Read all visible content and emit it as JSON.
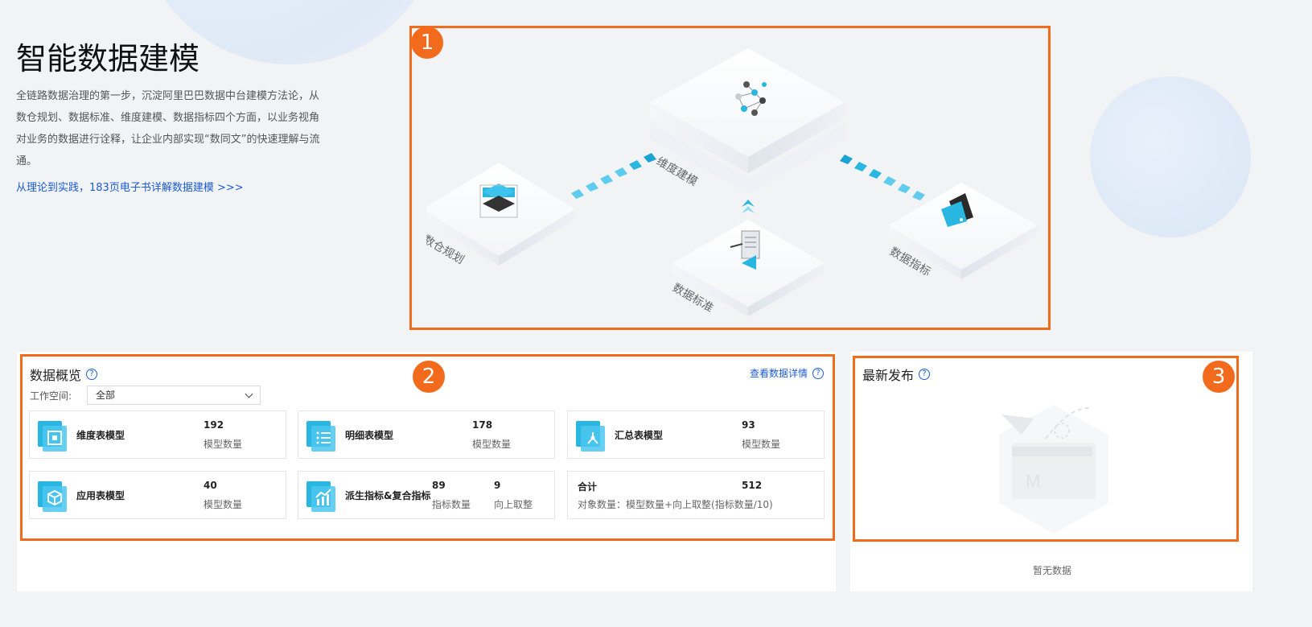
{
  "hero": {
    "title": "智能数据建模",
    "description": "全链路数据治理的第一步，沉淀阿里巴巴数据中台建模方法论，从数仓规划、数据标准、维度建模、数据指标四个方面，以业务视角对业务的数据进行诠释，让企业内部实现“数同文”的快速理解与流通。",
    "link": "从理论到实践，183页电子书详解数据建模 >>>"
  },
  "badges": [
    "1",
    "2",
    "3"
  ],
  "diagram": {
    "nodes": {
      "planning": "数仓规划",
      "dimension": "维度建模",
      "standard": "数据标准",
      "metric": "数据指标"
    }
  },
  "overview": {
    "title": "数据概览",
    "details_link": "查看数据详情",
    "workspace_label": "工作空间:",
    "workspace_value": "全部",
    "cards": [
      {
        "name": "维度表模型",
        "value": "192",
        "sub": "模型数量",
        "icon": "dimension-table-icon"
      },
      {
        "name": "明细表模型",
        "value": "178",
        "sub": "模型数量",
        "icon": "detail-table-icon"
      },
      {
        "name": "汇总表模型",
        "value": "93",
        "sub": "模型数量",
        "icon": "summary-table-icon"
      },
      {
        "name": "应用表模型",
        "value": "40",
        "sub": "模型数量",
        "icon": "application-table-icon"
      },
      {
        "name": "派生指标&复合指标",
        "value": "89",
        "sub": "指标数量",
        "value2": "9",
        "sub2": "向上取整",
        "icon": "derived-metric-icon"
      }
    ],
    "total": {
      "label": "合计",
      "value": "512",
      "formula": "对象数量：模型数量+向上取整(指标数量/10)"
    }
  },
  "latest": {
    "title": "最新发布",
    "empty_text": "暂无数据"
  },
  "colors": {
    "accent": "#f26b1d",
    "link": "#1b5bd8",
    "cyan": "#29b6e0"
  }
}
